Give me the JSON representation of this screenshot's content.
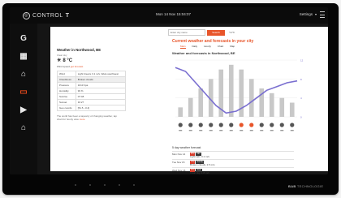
{
  "app": {
    "brand_name": "CONTROL",
    "brand_suffix": "T",
    "clock": "Mon 14 Nov 15:04:07",
    "settings_label": "Settings"
  },
  "sidebar": {
    "items": [
      {
        "icon": "google-icon",
        "glyph": "G",
        "active": false
      },
      {
        "icon": "dashboard-icon",
        "glyph": "▦",
        "active": false
      },
      {
        "icon": "home-icon",
        "glyph": "⌂",
        "active": false
      },
      {
        "icon": "chat-icon",
        "glyph": "▭",
        "active": true
      },
      {
        "icon": "camera-icon",
        "glyph": "▶",
        "active": false
      },
      {
        "icon": "house-icon",
        "glyph": "⌂",
        "active": false
      }
    ]
  },
  "browser": {
    "search_placeholder": "Enter city name",
    "search_button": "Search",
    "cc_link": "°C/°F",
    "headline": "Current weather and forecasts in your city",
    "tabs": [
      "Main",
      "Daily",
      "Hourly",
      "Chart",
      "Map"
    ],
    "left": {
      "title": "Weather in Northwood, BE",
      "subtitle": "Clear sky",
      "temp_icon": "☀",
      "temp": "8 °C",
      "meta_label": "Wind speed",
      "meta_link": "get forecast",
      "table": [
        {
          "k": "Wind",
          "v": "Light breeze 3.1 m/s, West-southwest"
        },
        {
          "k": "Cloudiness",
          "v": "Broken clouds"
        },
        {
          "k": "Pressure",
          "v": "1013 hpa"
        },
        {
          "k": "Humidity",
          "v": "93 %"
        },
        {
          "k": "Sunrise",
          "v": "07:48"
        },
        {
          "k": "Sunset",
          "v": "16:27"
        },
        {
          "k": "Geo coords",
          "v": "[51.5, -0.4]"
        }
      ],
      "note": "The world has been a tapestry of changing weather, tap chart for hourly view",
      "note_link": "more"
    },
    "chart_title": "Weather and forecasts in Northwood, BE",
    "bottom": {
      "title": "5 day weather forecast",
      "rows": [
        {
          "label": "Mon Nov 14",
          "badges": [
            "8°C",
            "rain"
          ],
          "desc": "Light rain, 3.1 m/s"
        },
        {
          "label": "Tue Nov 15",
          "badges": [
            "7°C",
            "cloudy"
          ],
          "desc": "Broken clouds, 2.5 m/s"
        },
        {
          "label": "Wed Nov 16",
          "badges": [
            "6°C",
            "clear"
          ],
          "desc": "Clear sky, 1.8 m/s"
        }
      ]
    }
  },
  "footer": {
    "brand": "BAB",
    "brand_suffix": "TECHNOLOGIE"
  },
  "chart_data": {
    "type": "line",
    "series": [
      {
        "values": [
          12,
          11,
          8,
          5,
          2,
          0,
          0.5,
          2,
          4,
          6,
          7,
          8,
          8.5
        ],
        "color": "#7a6fd0"
      }
    ],
    "bars": [
      2,
      4,
      6,
      8,
      10,
      11,
      10,
      8,
      6,
      5,
      4,
      3
    ],
    "y_ticks": [
      "12",
      "8",
      "4",
      "0"
    ]
  }
}
